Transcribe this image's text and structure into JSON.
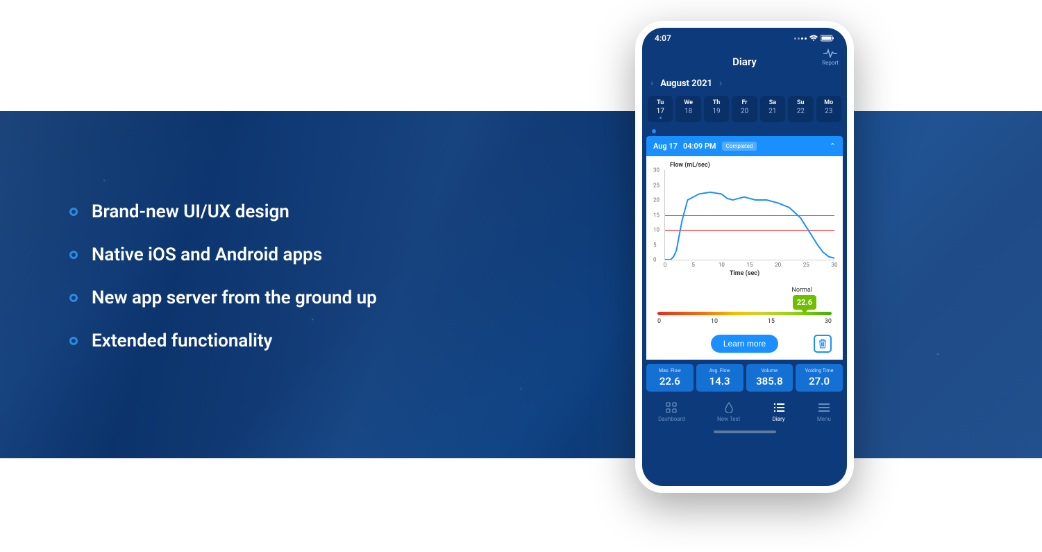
{
  "marketing": {
    "bullets": [
      "Brand-new UI/UX design",
      "Native iOS and Android apps",
      "New app server from the ground up",
      "Extended functionality"
    ]
  },
  "phone": {
    "status_time": "4:07",
    "title": "Diary",
    "report_label": "Report",
    "month_label": "August 2021",
    "days": [
      {
        "dow": "Tu",
        "num": "17",
        "active": true,
        "marked": true
      },
      {
        "dow": "We",
        "num": "18",
        "active": false,
        "marked": false
      },
      {
        "dow": "Th",
        "num": "19",
        "active": false,
        "marked": false
      },
      {
        "dow": "Fr",
        "num": "20",
        "active": false,
        "marked": false
      },
      {
        "dow": "Sa",
        "num": "21",
        "active": false,
        "marked": false
      },
      {
        "dow": "Su",
        "num": "22",
        "active": false,
        "marked": false
      },
      {
        "dow": "Mo",
        "num": "23",
        "active": false,
        "marked": false
      }
    ],
    "entry": {
      "date": "Aug 17",
      "time": "04:09 PM",
      "status": "Completed"
    },
    "chart_y_label": "Flow (mL/sec)",
    "chart_x_label": "Time (sec)",
    "scale": {
      "label": "Normal",
      "value": "22.6",
      "ticks": [
        "0",
        "10",
        "15",
        "30"
      ]
    },
    "learn_more": "Learn more",
    "stats": [
      {
        "label": "Max. Flow",
        "value": "22.6"
      },
      {
        "label": "Avg. Flow",
        "value": "14.3"
      },
      {
        "label": "Volume",
        "value": "385.8"
      },
      {
        "label": "Voiding Time",
        "value": "27.0"
      }
    ],
    "tabs": [
      {
        "label": "Dashboard",
        "icon": "grid"
      },
      {
        "label": "New Test",
        "icon": "drop"
      },
      {
        "label": "Diary",
        "icon": "list"
      },
      {
        "label": "Menu",
        "icon": "menu"
      }
    ]
  },
  "chart_data": {
    "type": "line",
    "title": "Flow (mL/sec)",
    "xlabel": "Time (sec)",
    "ylabel": "Flow (mL/sec)",
    "xlim": [
      0,
      30
    ],
    "ylim": [
      0,
      30
    ],
    "x_ticks": [
      0,
      5,
      10,
      15,
      20,
      25,
      30
    ],
    "y_ticks": [
      0,
      5,
      10,
      15,
      20,
      25,
      30
    ],
    "reference_lines": [
      {
        "y": 15,
        "color": "#00c000"
      },
      {
        "y": 10,
        "color": "#e00000"
      }
    ],
    "series": [
      {
        "name": "Flow",
        "x": [
          0,
          1,
          1.5,
          2,
          3,
          4,
          5,
          6,
          8,
          10,
          11,
          12,
          13,
          14,
          16,
          18,
          20,
          22,
          24,
          25,
          26,
          27,
          28,
          29,
          30
        ],
        "y": [
          0,
          0,
          1,
          3,
          13,
          20,
          21,
          22,
          22.6,
          22,
          20.5,
          20,
          20.5,
          21,
          20,
          20,
          19,
          17.5,
          14,
          11,
          8,
          5,
          2.5,
          1,
          0.5
        ]
      }
    ]
  }
}
